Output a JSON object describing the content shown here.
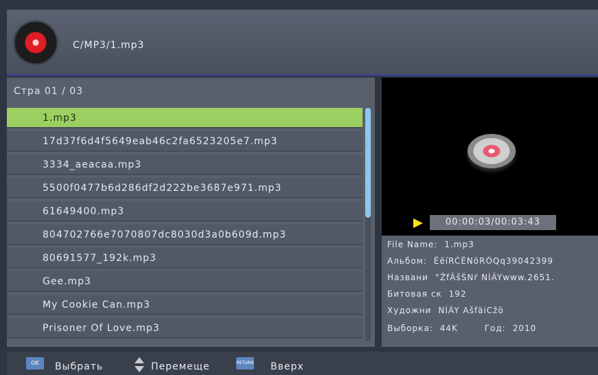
{
  "header": {
    "path": "C/MP3/1.mp3",
    "icon": "vinyl-disc-icon"
  },
  "browser": {
    "page_indicator": "Стра  01 / 03",
    "files": [
      "1.mp3",
      "17d37f6d4f5649eab46c2fa6523205e7.mp3",
      "3334_aeacaa.mp3",
      "5500f0477b6d286df2d222be3687e971.mp3",
      "61649400.mp3",
      "804702766e7070807dc8030d3a0b609d.mp3",
      "80691577_192k.mp3",
      "Gee.mp3",
      "My Cookie Can.mp3",
      "Prisoner Of Love.mp3"
    ],
    "selected_index": 0
  },
  "player": {
    "time": "00:00:03/00:03:43",
    "state_icon": "play-icon"
  },
  "info": {
    "file_name_label": "File Name:",
    "file_name": "1.mp3",
    "album_label": "Альбом:",
    "album": "ÊëíRČÊNöRÔQq39042399",
    "title_label": "Названи",
    "title": "°ŽfÂšŠNŕ  NÍÂYwww.2651.",
    "bitrate_label": "Битовая ск",
    "bitrate": "192",
    "artist_label": "Художни",
    "artist": "NÍÂY AšfäiCžö",
    "sample_label": "Выборка:",
    "sample": "44K",
    "year_label": "Год:",
    "year": "2010"
  },
  "footer": {
    "select_icon": "OK",
    "select_label": "Выбрать",
    "move_label": "Перемеще",
    "up_icon": "RETURN",
    "up_label": "Вверх"
  },
  "colors": {
    "selection": "#9ccf61",
    "accent": "#3b3e8a",
    "play": "#f7e21a"
  }
}
